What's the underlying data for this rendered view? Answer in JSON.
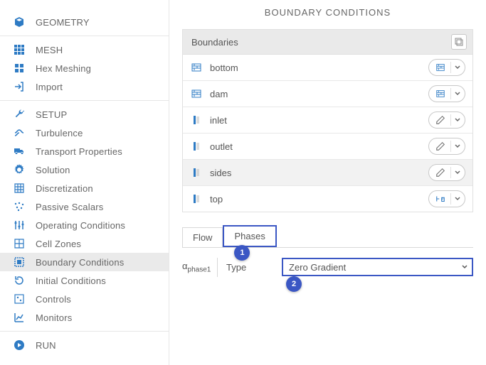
{
  "sidebar": {
    "sections": {
      "geometry": {
        "header": "GEOMETRY"
      },
      "mesh": {
        "header": "MESH",
        "items": [
          "Hex Meshing",
          "Import"
        ]
      },
      "setup": {
        "header": "SETUP",
        "items": [
          "Turbulence",
          "Transport Properties",
          "Solution",
          "Discretization",
          "Passive Scalars",
          "Operating Conditions",
          "Cell Zones",
          "Boundary Conditions",
          "Initial Conditions",
          "Controls",
          "Monitors"
        ]
      },
      "run": {
        "header": "RUN"
      }
    }
  },
  "main": {
    "title": "BOUNDARY CONDITIONS",
    "boundaries": {
      "header": "Boundaries",
      "rows": [
        {
          "name": "bottom",
          "kind": "wall"
        },
        {
          "name": "dam",
          "kind": "wall"
        },
        {
          "name": "inlet",
          "kind": "patch"
        },
        {
          "name": "outlet",
          "kind": "patch"
        },
        {
          "name": "sides",
          "kind": "patch"
        },
        {
          "name": "top",
          "kind": "atm"
        }
      ]
    },
    "tabs": {
      "flow": "Flow",
      "phases": "Phases",
      "active": "phases"
    },
    "form": {
      "alpha_label": "α",
      "alpha_sub": "phase1",
      "type_label": "Type",
      "type_value": "Zero Gradient"
    },
    "callouts": {
      "one": "1",
      "two": "2"
    }
  }
}
